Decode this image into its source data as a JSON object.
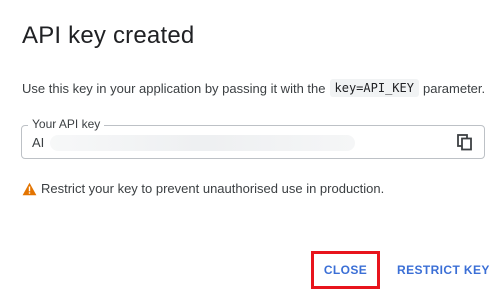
{
  "dialog": {
    "title": "API key created",
    "description_prefix": "Use this key in your application by passing it with the",
    "code_param": "key=API_KEY",
    "description_suffix": "parameter.",
    "field": {
      "label": "Your API key",
      "value": "AI"
    },
    "warning_text": "Restrict your key to prevent unauthorised use in production.",
    "buttons": {
      "close": "CLOSE",
      "restrict": "RESTRICT KEY"
    },
    "colors": {
      "accent": "#3b6fd6",
      "highlight_border": "#e8141c",
      "warning": "#e37400"
    },
    "icons": {
      "copy": "copy-icon",
      "warning": "warning-icon"
    }
  }
}
